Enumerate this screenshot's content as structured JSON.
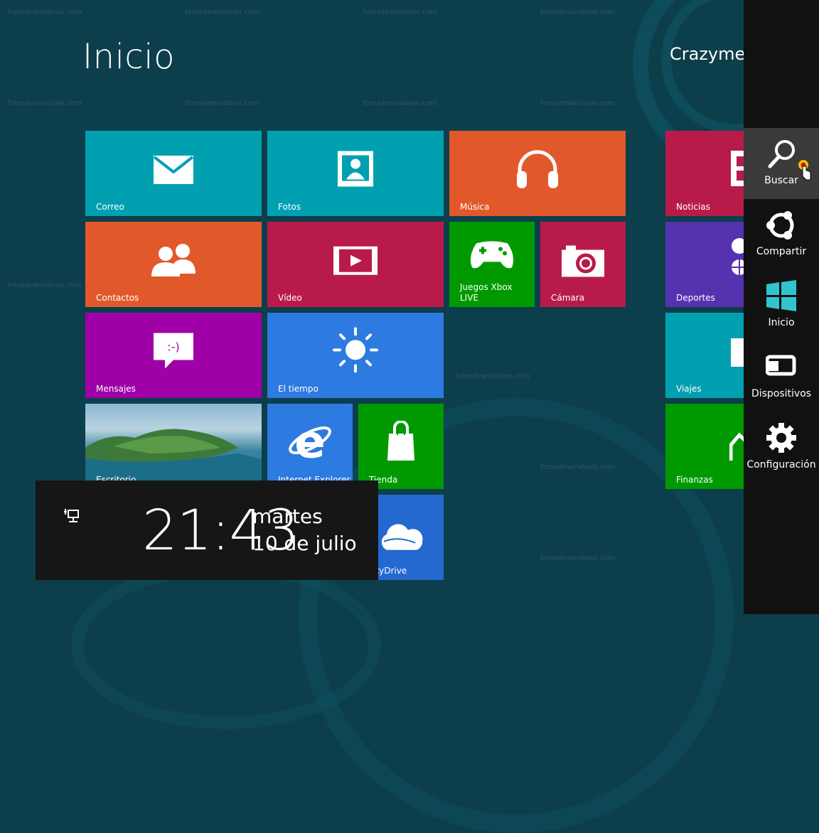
{
  "start": {
    "title": "Inicio",
    "user_name": "Crazymen",
    "watermark": "forosdewindows.com"
  },
  "tiles": [
    {
      "id": "mail",
      "label": "Correo",
      "color": "#00a0b1",
      "icon": "mail-icon"
    },
    {
      "id": "photos",
      "label": "Fotos",
      "color": "#00a0b1",
      "icon": "photo-icon"
    },
    {
      "id": "music",
      "label": "Música",
      "color": "#e1592a",
      "icon": "headphones-icon"
    },
    {
      "id": "news",
      "label": "Noticias",
      "color": "#b81b4a",
      "icon": "newspaper-icon"
    },
    {
      "id": "people",
      "label": "Contactos",
      "color": "#e1592a",
      "icon": "people-icon"
    },
    {
      "id": "video",
      "label": "Vídeo",
      "color": "#b81b4a",
      "icon": "video-play-icon"
    },
    {
      "id": "xbox",
      "label": "Juegos Xbox\nLIVE",
      "color": "#009a00",
      "icon": "gamepad-icon"
    },
    {
      "id": "camera",
      "label": "Cámara",
      "color": "#b81b4a",
      "icon": "camera-icon"
    },
    {
      "id": "sports",
      "label": "Deportes",
      "color": "#5532b0",
      "icon": "sports-ball-icon"
    },
    {
      "id": "messages",
      "label": "Mensajes",
      "color": "#9f00a7",
      "icon": "chat-bubble-icon"
    },
    {
      "id": "weather",
      "label": "El tiempo",
      "color": "#2d7ae0",
      "icon": "sun-icon"
    },
    {
      "id": "travel",
      "label": "Viajes",
      "color": "#00a0b1",
      "icon": "suitcase-icon"
    },
    {
      "id": "desktop",
      "label": "Escritorio",
      "color": "#1a6a8a",
      "icon": "landscape-image"
    },
    {
      "id": "ie",
      "label": "Internet Explorer",
      "color": "#2d7ae0",
      "icon": "internet-explorer-icon"
    },
    {
      "id": "store",
      "label": "Tienda",
      "color": "#009a00",
      "icon": "shopping-bag-icon"
    },
    {
      "id": "finance",
      "label": "Finanzas",
      "color": "#009a00",
      "icon": "stock-chart-icon"
    },
    {
      "id": "skydrive",
      "label": "SkyDrive",
      "color": "#2469cf",
      "icon": "cloud-icon"
    }
  ],
  "clock": {
    "time": "21:43",
    "day": "martes",
    "date": "10 de julio",
    "network_icon": "network-icon"
  },
  "charms": [
    {
      "id": "search",
      "label": "Buscar",
      "icon": "search-icon",
      "active": true
    },
    {
      "id": "share",
      "label": "Compartir",
      "icon": "share-icon",
      "active": false
    },
    {
      "id": "start",
      "label": "Inicio",
      "icon": "windows-logo-icon",
      "active": false
    },
    {
      "id": "devices",
      "label": "Dispositivos",
      "icon": "devices-icon",
      "active": false
    },
    {
      "id": "settings",
      "label": "Configuración",
      "icon": "gear-icon",
      "active": false
    }
  ],
  "colors": {
    "background": "#0d3e4c",
    "charms_bar": "#111111",
    "charm_active": "#3a3a3a",
    "clock_overlay": "#161616",
    "windows_logo": "#2fc5d0"
  }
}
